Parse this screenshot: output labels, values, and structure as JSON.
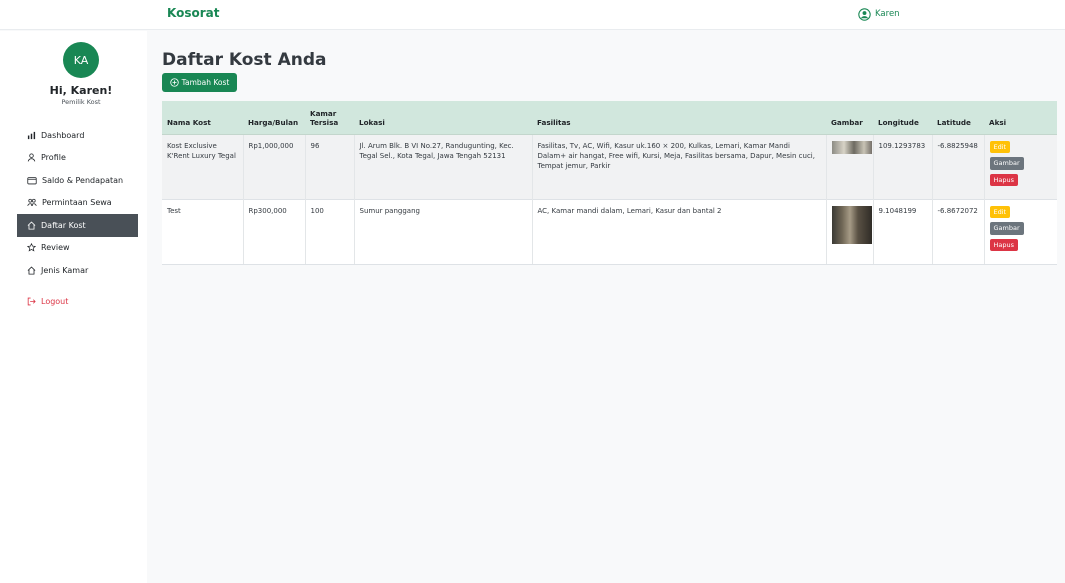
{
  "topbar": {
    "brand": "Kosorat",
    "user_name": "Karen"
  },
  "sidebar": {
    "avatar_initials": "KA",
    "greeting": "Hi, Karen!",
    "role": "Pemilik Kost",
    "items": [
      {
        "label": "Dashboard",
        "icon": "bar-chart-icon"
      },
      {
        "label": "Profile",
        "icon": "person-icon"
      },
      {
        "label": "Saldo & Pendapatan",
        "icon": "wallet-icon"
      },
      {
        "label": "Permintaan Sewa",
        "icon": "people-icon"
      },
      {
        "label": "Daftar Kost",
        "icon": "house-icon",
        "active": true
      },
      {
        "label": "Review",
        "icon": "star-icon"
      },
      {
        "label": "Jenis Kamar",
        "icon": "house-icon"
      }
    ],
    "logout_label": "Logout"
  },
  "main": {
    "title": "Daftar Kost Anda",
    "add_button": "Tambah Kost",
    "table": {
      "headers": [
        "Nama Kost",
        "Harga/Bulan",
        "Kamar Tersisa",
        "Lokasi",
        "Fasilitas",
        "Gambar",
        "Longitude",
        "Latitude",
        "Aksi"
      ],
      "rows": [
        {
          "nama": "Kost Exclusive K'Rent Luxury Tegal",
          "harga": "Rp1,000,000",
          "kamar": "96",
          "lokasi": "Jl. Arum Blk. B VI No.27, Randugunting, Kec. Tegal Sel., Kota Tegal, Jawa Tengah 52131",
          "fasilitas": "Fasilitas, Tv, AC, Wifi, Kasur uk.160 × 200, Kulkas, Lemari, Kamar Mandi Dalam+ air hangat, Free wifi, Kursi, Meja, Fasilitas bersama, Dapur, Mesin cuci, Tempat jemur, Parkir",
          "longitude": "109.1293783",
          "latitude": "-6.8825948"
        },
        {
          "nama": "Test",
          "harga": "Rp300,000",
          "kamar": "100",
          "lokasi": "Sumur panggang",
          "fasilitas": "AC, Kamar mandi dalam, Lemari, Kasur dan bantal 2",
          "longitude": "9.1048199",
          "latitude": "-6.8672072"
        }
      ],
      "actions": {
        "edit": "Edit",
        "gambar": "Gambar",
        "hapus": "Hapus"
      }
    }
  },
  "colors": {
    "brand": "#198754",
    "header_bg": "#d1e7dd",
    "active_nav": "#495057",
    "danger": "#dc3545",
    "warning": "#ffc107",
    "secondary": "#6c757d"
  }
}
